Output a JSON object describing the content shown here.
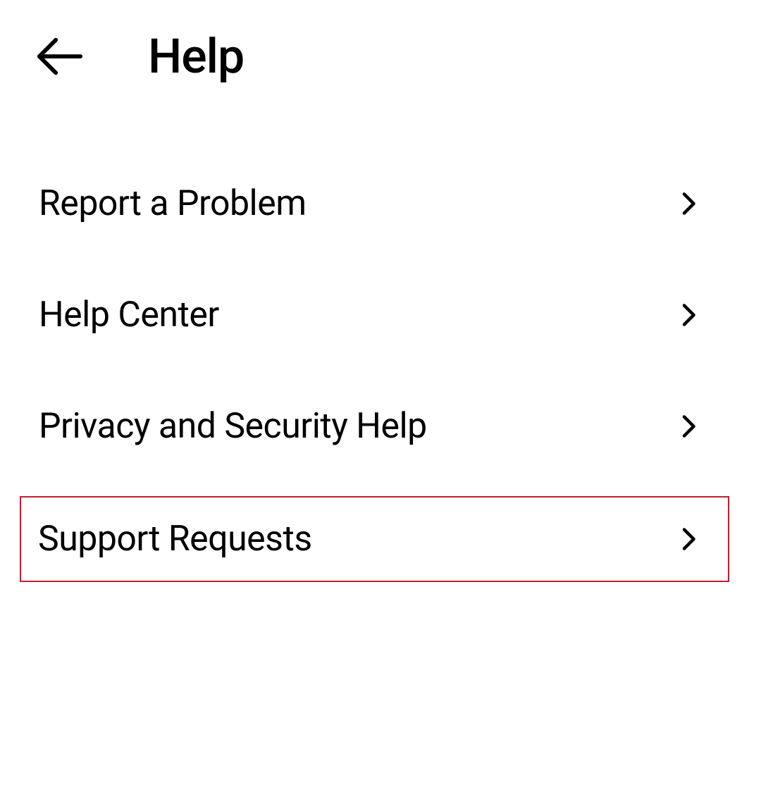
{
  "header": {
    "title": "Help"
  },
  "menu": {
    "items": [
      {
        "label": "Report a Problem",
        "highlighted": false
      },
      {
        "label": "Help Center",
        "highlighted": false
      },
      {
        "label": "Privacy and Security Help",
        "highlighted": false
      },
      {
        "label": "Support Requests",
        "highlighted": true
      }
    ]
  }
}
